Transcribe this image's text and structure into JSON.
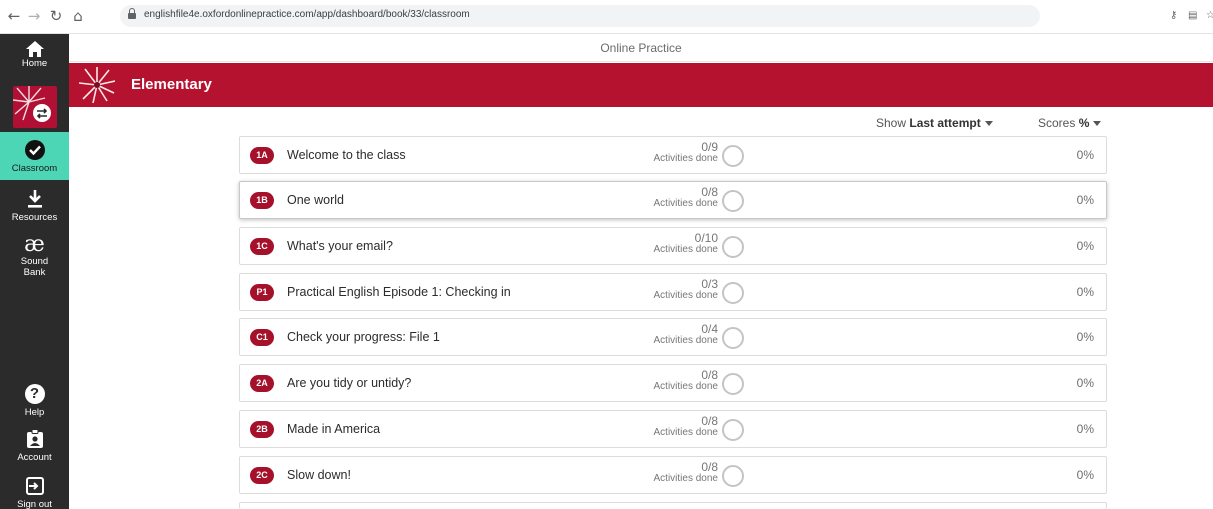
{
  "browser": {
    "url": "englishfile4e.oxfordonlinepractice.com/app/dashboard/book/33/classroom"
  },
  "sidebar": {
    "items": [
      {
        "id": "home",
        "label": "Home",
        "icon": "home-icon"
      },
      {
        "id": "switch",
        "label": "",
        "icon": "switch-course-icon"
      },
      {
        "id": "classroom",
        "label": "Classroom",
        "icon": "check-circle-icon",
        "active": true
      },
      {
        "id": "resources",
        "label": "Resources",
        "icon": "download-icon"
      },
      {
        "id": "soundbank",
        "label": "Sound Bank",
        "label_line1": "Sound",
        "label_line2": "Bank",
        "icon": "ae-ligature-icon",
        "glyph": "æ"
      },
      {
        "id": "help",
        "label": "Help",
        "icon": "help-icon",
        "glyph": "?"
      },
      {
        "id": "account",
        "label": "Account",
        "icon": "account-badge-icon"
      },
      {
        "id": "signout",
        "label": "Sign out",
        "icon": "sign-out-icon"
      }
    ]
  },
  "header": {
    "title": "Online Practice"
  },
  "course": {
    "title": "Elementary",
    "accent": "#b5122f"
  },
  "filters": {
    "show_label": "Show",
    "show_value": "Last attempt",
    "scores_label": "Scores",
    "scores_value": "%"
  },
  "activities_label": "Activities done",
  "units": [
    {
      "badge": "1A",
      "title": "Welcome to the class",
      "count": "0/9",
      "score": "0%"
    },
    {
      "badge": "1B",
      "title": "One world",
      "count": "0/8",
      "score": "0%"
    },
    {
      "badge": "1C",
      "title": "What's your email?",
      "count": "0/10",
      "score": "0%"
    },
    {
      "badge": "P1",
      "title": "Practical English Episode 1: Checking in",
      "count": "0/3",
      "score": "0%"
    },
    {
      "badge": "C1",
      "title": "Check your progress: File 1",
      "count": "0/4",
      "score": "0%"
    },
    {
      "badge": "2A",
      "title": "Are you tidy or untidy?",
      "count": "0/8",
      "score": "0%"
    },
    {
      "badge": "2B",
      "title": "Made in America",
      "count": "0/8",
      "score": "0%"
    },
    {
      "badge": "2C",
      "title": "Slow down!",
      "count": "0/8",
      "score": "0%"
    }
  ]
}
